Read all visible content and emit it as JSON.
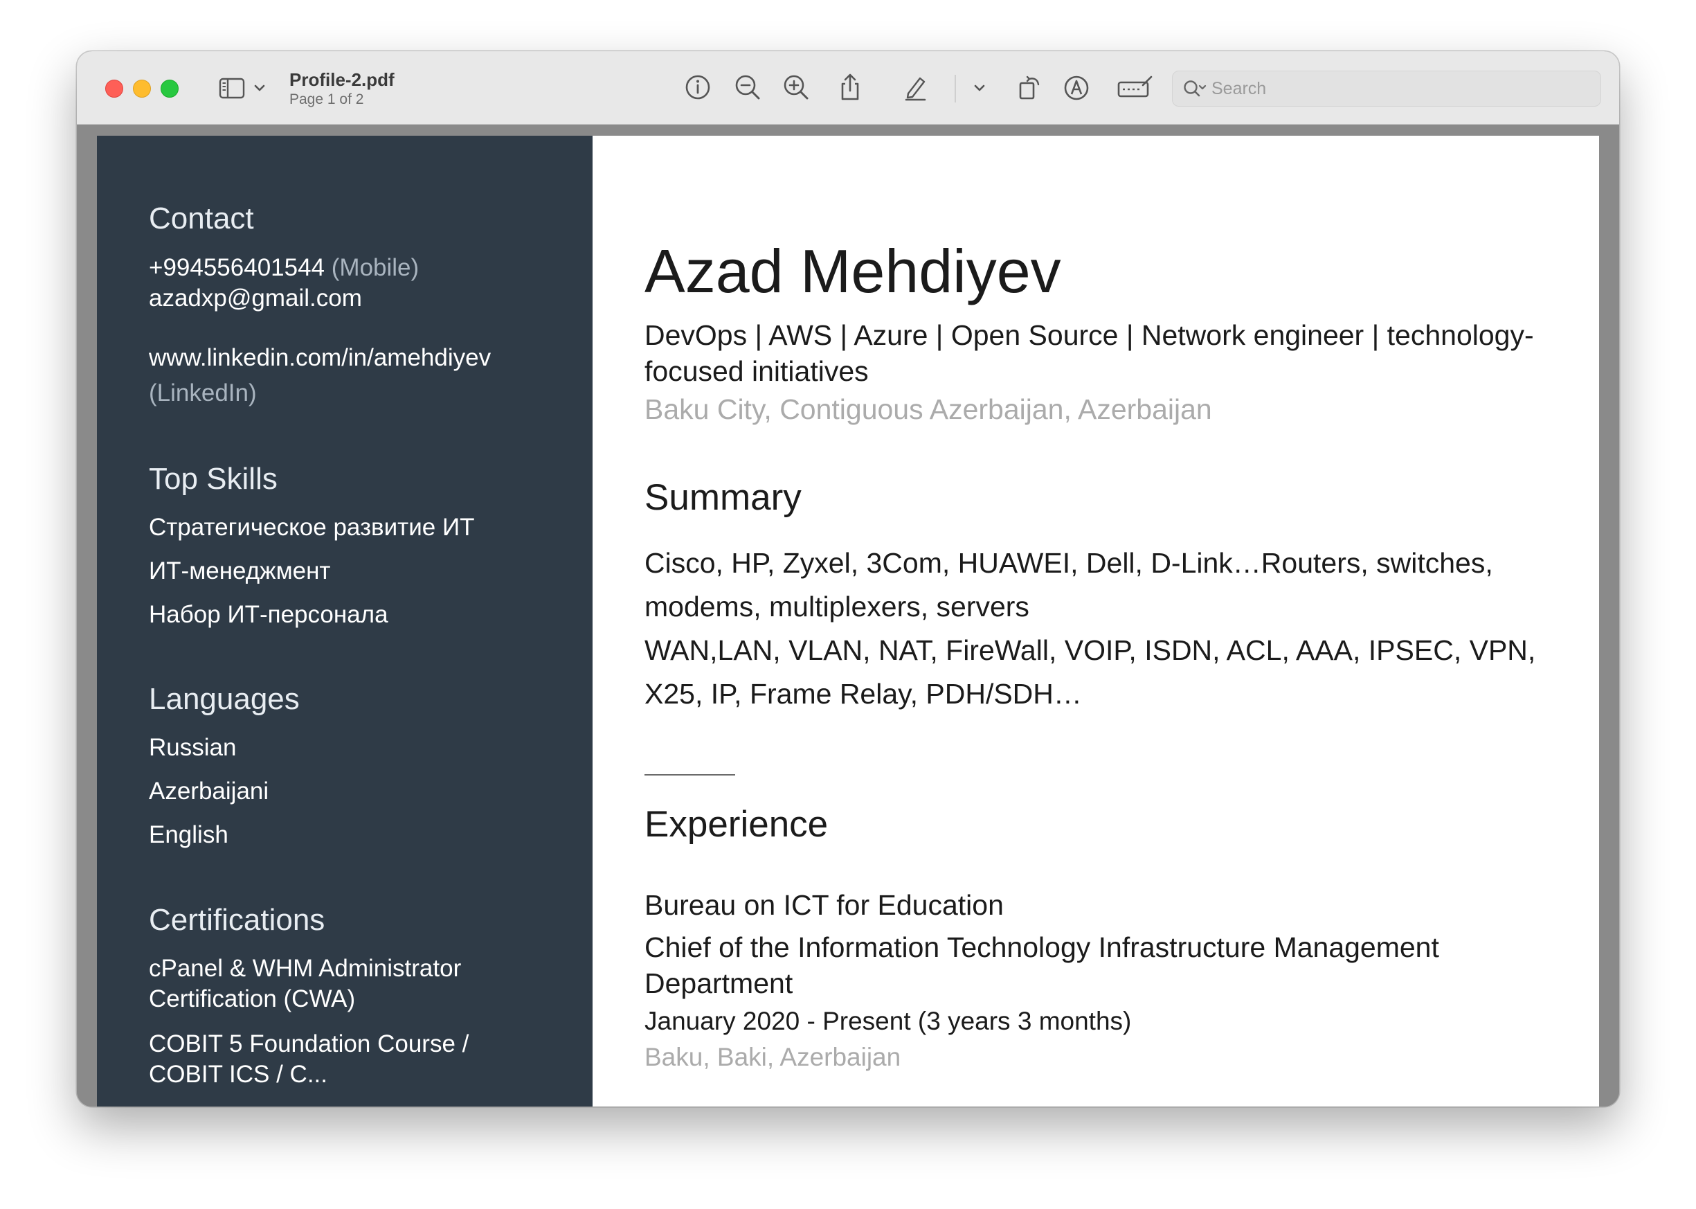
{
  "window": {
    "title": "Profile-2.pdf",
    "subtitle": "Page 1 of 2"
  },
  "toolbar": {
    "icons": [
      "sidebar-icon",
      "chevron-down-icon",
      "info-icon",
      "zoom-out-icon",
      "zoom-in-icon",
      "share-icon",
      "highlight-pen-icon",
      "chevron-down-icon",
      "rotate-icon",
      "markup-icon",
      "form-fill-icon"
    ],
    "search_placeholder": "Search"
  },
  "resume": {
    "contact": {
      "heading": "Contact",
      "phone": "+994556401544",
      "phone_type": "(Mobile)",
      "email": "azadxp@gmail.com",
      "linkedin": "www.linkedin.com/in/amehdiyev",
      "linkedin_label": "(LinkedIn)"
    },
    "top_skills": {
      "heading": "Top Skills",
      "items": [
        "Стратегическое развитие ИТ",
        "ИТ-менеджмент",
        "Набор ИТ-персонала"
      ]
    },
    "languages": {
      "heading": "Languages",
      "items": [
        "Russian",
        "Azerbaijani",
        "English"
      ]
    },
    "certifications": {
      "heading": "Certifications",
      "item1_line1": "cPanel & WHM Administrator",
      "item1_line2": "Certification (CWA)",
      "item2_line1": "COBIT 5 Foundation Course /",
      "item2_line2": "COBIT ICS / C..."
    },
    "name": "Azad Mehdiyev",
    "headline": "DevOps | AWS | Azure | Open Source | Network engineer | technology-focused initiatives",
    "location": "Baku City, Contiguous Azerbaijan, Azerbaijan",
    "summary": {
      "heading": "Summary",
      "paragraph1": "Cisco, HP, Zyxel, 3Com, HUAWEI, Dell, D-Link…Routers, switches, modems, multiplexers, servers",
      "paragraph2": "WAN,LAN, VLAN, NAT, FireWall, VOIP, ISDN, ACL, AAA, IPSEC, VPN, X25, IP, Frame Relay, PDH/SDH…"
    },
    "experience": {
      "heading": "Experience",
      "company": "Bureau on ICT for Education",
      "title": "Chief of the Information Technology Infrastructure Management Department",
      "dates": "January 2020 - Present (3 years 3 months)",
      "location": "Baku, Baki, Azerbaijan"
    }
  },
  "colors": {
    "sidebar_bg": "#2f3b47",
    "muted_text": "#ababab",
    "close": "#fe5f57",
    "minimize": "#febc2e",
    "maximize": "#28c840"
  }
}
